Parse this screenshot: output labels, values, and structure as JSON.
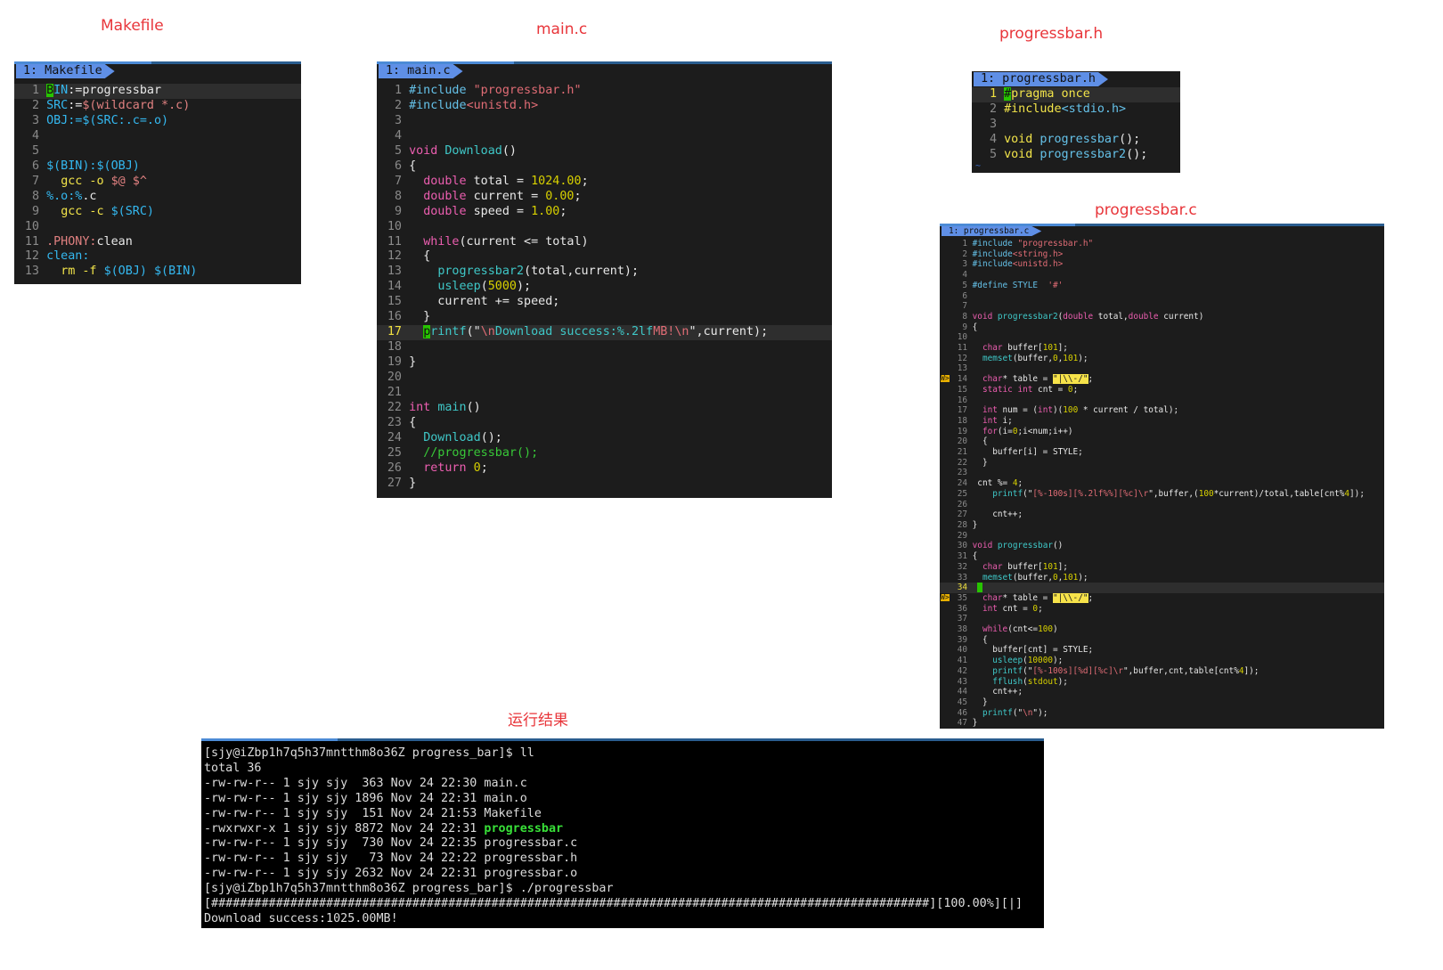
{
  "labels": {
    "makefile": "Makefile",
    "main_c": "main.c",
    "progressbar_h": "progressbar.h",
    "progressbar_c": "progressbar.c",
    "result": "运行结果"
  },
  "tabs": {
    "makefile": "1: Makefile",
    "main_c": "1: main.c",
    "progressbar_h": "1: progressbar.h",
    "progressbar_c": "1: progressbar.c"
  },
  "colors": {
    "title_red": "#e8353a",
    "editor_bg": "#1c1c1c",
    "tab_blue": "#5f8fe6",
    "cursor_green": "#27c400",
    "warning_yellow": "#e8b000"
  },
  "makefile_lines": [
    {
      "n": "1",
      "cur": true,
      "toks": [
        [
          "cursor",
          "B"
        ],
        [
          "pp",
          "IN"
        ],
        [
          "t",
          ":=progressbar"
        ]
      ]
    },
    {
      "n": "2",
      "toks": [
        [
          "pp",
          "SRC"
        ],
        [
          "t",
          ":="
        ],
        [
          "mk",
          "$("
        ],
        [
          "mk",
          "wildcard"
        ],
        [
          "mk",
          " *.c"
        ],
        [
          "mk",
          ")"
        ]
      ]
    },
    {
      "n": "3",
      "toks": [
        [
          "pp",
          "OBJ:=$(SRC:.c=.o)"
        ]
      ]
    },
    {
      "n": "4",
      "toks": []
    },
    {
      "n": "5",
      "toks": []
    },
    {
      "n": "6",
      "toks": [
        [
          "pp",
          "$(BIN):$(OBJ)"
        ]
      ]
    },
    {
      "n": "7",
      "toks": [
        [
          "t",
          "  "
        ],
        [
          "y",
          "gcc -o "
        ],
        [
          "mk",
          "$@ $^"
        ]
      ]
    },
    {
      "n": "8",
      "toks": [
        [
          "pp",
          "%.o:%"
        ],
        [
          "t",
          ".c"
        ]
      ]
    },
    {
      "n": "9",
      "toks": [
        [
          "t",
          "  "
        ],
        [
          "y",
          "gcc -c "
        ],
        [
          "pp",
          "$(SRC)"
        ]
      ]
    },
    {
      "n": "10",
      "toks": []
    },
    {
      "n": "11",
      "toks": [
        [
          "mk",
          ".PHONY:"
        ],
        [
          "t",
          "clean"
        ]
      ]
    },
    {
      "n": "12",
      "toks": [
        [
          "pp",
          "clean:"
        ]
      ]
    },
    {
      "n": "13",
      "toks": [
        [
          "t",
          "  "
        ],
        [
          "y",
          "rm -f "
        ],
        [
          "pp",
          "$(OBJ) $(BIN)"
        ]
      ]
    }
  ],
  "main_lines": [
    {
      "n": "1",
      "toks": [
        [
          "pre",
          "#include "
        ],
        [
          "str",
          "\"progressbar.h\""
        ]
      ]
    },
    {
      "n": "2",
      "toks": [
        [
          "pre",
          "#include"
        ],
        [
          "str",
          "<unistd.h>"
        ]
      ]
    },
    {
      "n": "3",
      "toks": []
    },
    {
      "n": "4",
      "toks": []
    },
    {
      "n": "5",
      "toks": [
        [
          "type",
          "void "
        ],
        [
          "fn",
          "Download"
        ],
        [
          "t",
          "()"
        ]
      ]
    },
    {
      "n": "6",
      "toks": [
        [
          "t",
          "{"
        ]
      ]
    },
    {
      "n": "7",
      "toks": [
        [
          "t",
          "  "
        ],
        [
          "type",
          "double"
        ],
        [
          "t",
          " total = "
        ],
        [
          "num",
          "1024.00"
        ],
        [
          "t",
          ";"
        ]
      ]
    },
    {
      "n": "8",
      "toks": [
        [
          "t",
          "  "
        ],
        [
          "type",
          "double"
        ],
        [
          "t",
          " current = "
        ],
        [
          "num",
          "0.00"
        ],
        [
          "t",
          ";"
        ]
      ]
    },
    {
      "n": "9",
      "toks": [
        [
          "t",
          "  "
        ],
        [
          "type",
          "double"
        ],
        [
          "t",
          " speed = "
        ],
        [
          "num",
          "1.00"
        ],
        [
          "t",
          ";"
        ]
      ]
    },
    {
      "n": "10",
      "toks": []
    },
    {
      "n": "11",
      "toks": [
        [
          "t",
          "  "
        ],
        [
          "type",
          "while"
        ],
        [
          "t",
          "(current <= total)"
        ]
      ]
    },
    {
      "n": "12",
      "toks": [
        [
          "t",
          "  {"
        ]
      ]
    },
    {
      "n": "13",
      "toks": [
        [
          "t",
          "    "
        ],
        [
          "fn",
          "progressbar2"
        ],
        [
          "t",
          "(total,current);"
        ]
      ]
    },
    {
      "n": "14",
      "toks": [
        [
          "t",
          "    "
        ],
        [
          "fn",
          "usleep"
        ],
        [
          "t",
          "("
        ],
        [
          "num",
          "5000"
        ],
        [
          "t",
          ");"
        ]
      ]
    },
    {
      "n": "15",
      "toks": [
        [
          "t",
          "    current += speed;"
        ]
      ]
    },
    {
      "n": "16",
      "toks": [
        [
          "t",
          "  }"
        ]
      ]
    },
    {
      "n": "17",
      "cur": true,
      "hl": true,
      "toks": [
        [
          "t",
          "  "
        ],
        [
          "cursor",
          "p"
        ],
        [
          "fn",
          "rintf"
        ],
        [
          "t",
          "(\""
        ],
        [
          "str",
          "\\n"
        ],
        [
          "fn",
          "Download success:%.2lf"
        ],
        [
          "str",
          "MB!\\n"
        ],
        [
          "t",
          "\",current);"
        ]
      ]
    },
    {
      "n": "18",
      "toks": []
    },
    {
      "n": "19",
      "toks": [
        [
          "t",
          "}"
        ]
      ]
    },
    {
      "n": "20",
      "toks": []
    },
    {
      "n": "21",
      "toks": []
    },
    {
      "n": "22",
      "toks": [
        [
          "type",
          "int "
        ],
        [
          "fn",
          "main"
        ],
        [
          "t",
          "()"
        ]
      ]
    },
    {
      "n": "23",
      "toks": [
        [
          "t",
          "{"
        ]
      ]
    },
    {
      "n": "24",
      "toks": [
        [
          "t",
          "  "
        ],
        [
          "fn",
          "Download"
        ],
        [
          "t",
          "();"
        ]
      ]
    },
    {
      "n": "25",
      "toks": [
        [
          "t",
          "  "
        ],
        [
          "cmt",
          "//progressbar();"
        ]
      ]
    },
    {
      "n": "26",
      "toks": [
        [
          "t",
          "  "
        ],
        [
          "type",
          "return "
        ],
        [
          "num",
          "0"
        ],
        [
          "t",
          ";"
        ]
      ]
    },
    {
      "n": "27",
      "toks": [
        [
          "t",
          "}"
        ]
      ]
    }
  ],
  "header_lines": [
    {
      "n": "1",
      "cur": true,
      "hl": true,
      "toks": [
        [
          "cursor",
          "#"
        ],
        [
          "y",
          "pragma once"
        ]
      ]
    },
    {
      "n": "2",
      "toks": [
        [
          "y",
          "#include"
        ],
        [
          "pre",
          "<stdio.h>"
        ]
      ]
    },
    {
      "n": "3",
      "toks": []
    },
    {
      "n": "4",
      "toks": [
        [
          "y",
          "void "
        ],
        [
          "pre",
          "progressbar"
        ],
        [
          "t",
          "();"
        ]
      ]
    },
    {
      "n": "5",
      "toks": [
        [
          "y",
          "void "
        ],
        [
          "pre",
          "progressbar2"
        ],
        [
          "t",
          "();"
        ]
      ]
    }
  ],
  "header_tilde": "~",
  "pbar_lines": [
    {
      "n": "1",
      "toks": [
        [
          "pre",
          "#include "
        ],
        [
          "str",
          "\"progressbar.h\""
        ]
      ]
    },
    {
      "n": "2",
      "toks": [
        [
          "pre",
          "#include"
        ],
        [
          "str",
          "<string.h>"
        ]
      ]
    },
    {
      "n": "3",
      "toks": [
        [
          "pre",
          "#include"
        ],
        [
          "str",
          "<unistd.h>"
        ]
      ]
    },
    {
      "n": "4",
      "toks": []
    },
    {
      "n": "5",
      "toks": [
        [
          "pre",
          "#define STYLE  "
        ],
        [
          "str",
          "'#'"
        ]
      ]
    },
    {
      "n": "6",
      "toks": []
    },
    {
      "n": "7",
      "toks": []
    },
    {
      "n": "8",
      "toks": [
        [
          "type",
          "void "
        ],
        [
          "fn",
          "progressbar2"
        ],
        [
          "t",
          "("
        ],
        [
          "type",
          "double"
        ],
        [
          "t",
          " total,"
        ],
        [
          "type",
          "double"
        ],
        [
          "t",
          " current)"
        ]
      ]
    },
    {
      "n": "9",
      "toks": [
        [
          "t",
          "{"
        ]
      ]
    },
    {
      "n": "10",
      "toks": []
    },
    {
      "n": "11",
      "toks": [
        [
          "t",
          "  "
        ],
        [
          "type",
          "char"
        ],
        [
          "t",
          " buffer["
        ],
        [
          "num",
          "101"
        ],
        [
          "t",
          "];"
        ]
      ]
    },
    {
      "n": "12",
      "toks": [
        [
          "t",
          "  "
        ],
        [
          "fn",
          "memset"
        ],
        [
          "t",
          "(buffer,"
        ],
        [
          "num",
          "0"
        ],
        [
          "t",
          ","
        ],
        [
          "num",
          "101"
        ],
        [
          "t",
          ");"
        ]
      ]
    },
    {
      "n": "13",
      "toks": []
    },
    {
      "n": "14",
      "sign": "W>",
      "toks": [
        [
          "t",
          "  "
        ],
        [
          "type",
          "char"
        ],
        [
          "t",
          "* table = "
        ],
        [
          "ystr",
          "\"|\\\\-/\""
        ],
        [
          "t",
          ";"
        ]
      ]
    },
    {
      "n": "15",
      "toks": [
        [
          "t",
          "  "
        ],
        [
          "type",
          "static int"
        ],
        [
          "t",
          " cnt = "
        ],
        [
          "num",
          "0"
        ],
        [
          "t",
          ";"
        ]
      ]
    },
    {
      "n": "16",
      "toks": []
    },
    {
      "n": "17",
      "toks": [
        [
          "t",
          "  "
        ],
        [
          "type",
          "int"
        ],
        [
          "t",
          " num = ("
        ],
        [
          "type",
          "int"
        ],
        [
          "t",
          ")("
        ],
        [
          "num",
          "100"
        ],
        [
          "t",
          " * current / total);"
        ]
      ]
    },
    {
      "n": "18",
      "toks": [
        [
          "t",
          "  "
        ],
        [
          "type",
          "int"
        ],
        [
          "t",
          " i;"
        ]
      ]
    },
    {
      "n": "19",
      "toks": [
        [
          "t",
          "  "
        ],
        [
          "type",
          "for"
        ],
        [
          "t",
          "(i="
        ],
        [
          "num",
          "0"
        ],
        [
          "t",
          ";i<num;i++)"
        ]
      ]
    },
    {
      "n": "20",
      "toks": [
        [
          "t",
          "  {"
        ]
      ]
    },
    {
      "n": "21",
      "toks": [
        [
          "t",
          "    buffer[i] = STYLE;"
        ]
      ]
    },
    {
      "n": "22",
      "toks": [
        [
          "t",
          "  }"
        ]
      ]
    },
    {
      "n": "23",
      "toks": []
    },
    {
      "n": "24",
      "toks": [
        [
          "t",
          " cnt %= "
        ],
        [
          "num",
          "4"
        ],
        [
          "t",
          ";"
        ]
      ]
    },
    {
      "n": "25",
      "toks": [
        [
          "t",
          "    "
        ],
        [
          "fn",
          "printf"
        ],
        [
          "t",
          "(\""
        ],
        [
          "str",
          "[%-100s][%.2lf%%][%c]\\r"
        ],
        [
          "t",
          "\",buffer,("
        ],
        [
          "num",
          "100"
        ],
        [
          "t",
          "*current)/total,table[cnt%"
        ],
        [
          "num",
          "4"
        ],
        [
          "t",
          "]);"
        ]
      ]
    },
    {
      "n": "26",
      "toks": []
    },
    {
      "n": "27",
      "toks": [
        [
          "t",
          "    cnt++;"
        ]
      ]
    },
    {
      "n": "28",
      "toks": [
        [
          "t",
          "}"
        ]
      ]
    },
    {
      "n": "29",
      "toks": []
    },
    {
      "n": "30",
      "toks": [
        [
          "type",
          "void "
        ],
        [
          "fn",
          "progressbar"
        ],
        [
          "t",
          "()"
        ]
      ]
    },
    {
      "n": "31",
      "toks": [
        [
          "t",
          "{"
        ]
      ]
    },
    {
      "n": "32",
      "toks": [
        [
          "t",
          "  "
        ],
        [
          "type",
          "char"
        ],
        [
          "t",
          " buffer["
        ],
        [
          "num",
          "101"
        ],
        [
          "t",
          "];"
        ]
      ]
    },
    {
      "n": "33",
      "toks": [
        [
          "t",
          "  "
        ],
        [
          "fn",
          "memset"
        ],
        [
          "t",
          "(buffer,"
        ],
        [
          "num",
          "0"
        ],
        [
          "t",
          ","
        ],
        [
          "num",
          "101"
        ],
        [
          "t",
          ");"
        ]
      ]
    },
    {
      "n": "34",
      "cur": true,
      "hl": true,
      "toks": [
        [
          "t",
          " "
        ],
        [
          "cursor",
          " "
        ]
      ]
    },
    {
      "n": "35",
      "sign": "W>",
      "toks": [
        [
          "t",
          "  "
        ],
        [
          "type",
          "char"
        ],
        [
          "t",
          "* table = "
        ],
        [
          "ystr",
          "\"|\\\\-/\""
        ],
        [
          "t",
          ";"
        ]
      ]
    },
    {
      "n": "36",
      "toks": [
        [
          "t",
          "  "
        ],
        [
          "type",
          "int"
        ],
        [
          "t",
          " cnt = "
        ],
        [
          "num",
          "0"
        ],
        [
          "t",
          ";"
        ]
      ]
    },
    {
      "n": "37",
      "toks": []
    },
    {
      "n": "38",
      "toks": [
        [
          "t",
          "  "
        ],
        [
          "type",
          "while"
        ],
        [
          "t",
          "(cnt<="
        ],
        [
          "num",
          "100"
        ],
        [
          "t",
          ")"
        ]
      ]
    },
    {
      "n": "39",
      "toks": [
        [
          "t",
          "  {"
        ]
      ]
    },
    {
      "n": "40",
      "toks": [
        [
          "t",
          "    buffer[cnt] = STYLE;"
        ]
      ]
    },
    {
      "n": "41",
      "toks": [
        [
          "t",
          "    "
        ],
        [
          "fn",
          "usleep"
        ],
        [
          "t",
          "("
        ],
        [
          "num",
          "10000"
        ],
        [
          "t",
          ");"
        ]
      ]
    },
    {
      "n": "42",
      "toks": [
        [
          "t",
          "    "
        ],
        [
          "fn",
          "printf"
        ],
        [
          "t",
          "(\""
        ],
        [
          "str",
          "[%-100s][%d][%c]\\r"
        ],
        [
          "t",
          "\",buffer,cnt,table[cnt%"
        ],
        [
          "num",
          "4"
        ],
        [
          "t",
          "]);"
        ]
      ]
    },
    {
      "n": "43",
      "toks": [
        [
          "t",
          "    "
        ],
        [
          "fn",
          "fflush"
        ],
        [
          "t",
          "("
        ],
        [
          "num",
          "stdout"
        ],
        [
          "t",
          ");"
        ]
      ]
    },
    {
      "n": "44",
      "toks": [
        [
          "t",
          "    cnt++;"
        ]
      ]
    },
    {
      "n": "45",
      "toks": [
        [
          "t",
          "  }"
        ]
      ]
    },
    {
      "n": "46",
      "toks": [
        [
          "t",
          "  "
        ],
        [
          "fn",
          "printf"
        ],
        [
          "t",
          "(\""
        ],
        [
          "str",
          "\\n"
        ],
        [
          "t",
          "\");"
        ]
      ]
    },
    {
      "n": "47",
      "toks": [
        [
          "t",
          "}"
        ]
      ]
    }
  ],
  "terminal_lines": [
    {
      "toks": [
        [
          "t",
          "[sjy@iZbp1h7q5h37mntthm8o36Z progress_bar]$ ll"
        ]
      ]
    },
    {
      "toks": [
        [
          "t",
          "total 36"
        ]
      ]
    },
    {
      "toks": [
        [
          "t",
          "-rw-rw-r-- 1 sjy sjy  363 Nov 24 22:30 main.c"
        ]
      ]
    },
    {
      "toks": [
        [
          "t",
          "-rw-rw-r-- 1 sjy sjy 1896 Nov 24 22:31 main.o"
        ]
      ]
    },
    {
      "toks": [
        [
          "t",
          "-rw-rw-r-- 1 sjy sjy  151 Nov 24 21:53 Makefile"
        ]
      ]
    },
    {
      "toks": [
        [
          "t",
          "-rwxrwxr-x 1 sjy sjy 8872 Nov 24 22:31 "
        ],
        [
          "green",
          "progressbar"
        ]
      ]
    },
    {
      "toks": [
        [
          "t",
          "-rw-rw-r-- 1 sjy sjy  730 Nov 24 22:35 progressbar.c"
        ]
      ]
    },
    {
      "toks": [
        [
          "t",
          "-rw-rw-r-- 1 sjy sjy   73 Nov 24 22:22 progressbar.h"
        ]
      ]
    },
    {
      "toks": [
        [
          "t",
          "-rw-rw-r-- 1 sjy sjy 2632 Nov 24 22:31 progressbar.o"
        ]
      ]
    },
    {
      "toks": [
        [
          "t",
          "[sjy@iZbp1h7q5h37mntthm8o36Z progress_bar]$ ./progressbar"
        ]
      ]
    },
    {
      "toks": [
        [
          "t",
          "[####################################################################################################][100.00%][|]"
        ]
      ]
    },
    {
      "toks": [
        [
          "t",
          "Download success:1025.00MB!"
        ]
      ]
    }
  ]
}
